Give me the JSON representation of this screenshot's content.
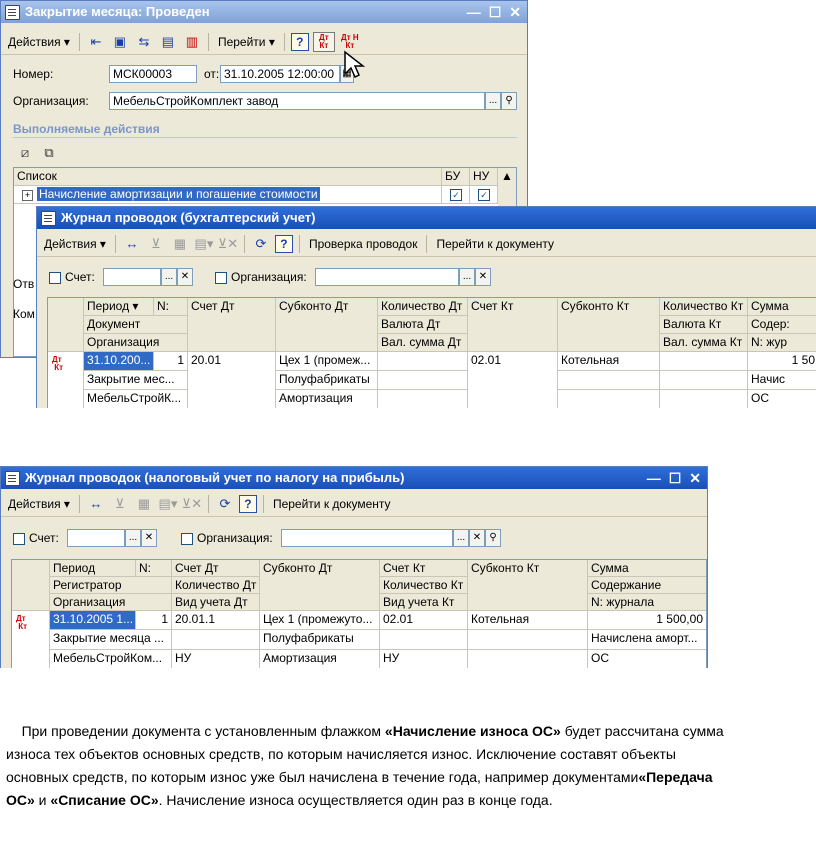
{
  "win1": {
    "title": "Закрытие месяца: Проведен",
    "toolbar": {
      "actions": "Действия ▾",
      "goto": "Перейти ▾",
      "help": "?",
      "dtkt_top": "Дт",
      "dtkt_bottom": "Кт",
      "dtkt2_top": "Дт Н",
      "dtkt2_bottom": "Кт"
    },
    "number_label": "Номер:",
    "number_value": "МСК00003",
    "date_label": "от:",
    "date_value": "31.10.2005 12:00:00",
    "org_label": "Организация:",
    "org_value": "МебельСтройКомплект завод",
    "section_label": "Выполняемые действия",
    "list": {
      "headers": {
        "list": "Список",
        "bu": "БУ",
        "nu": "НУ"
      },
      "first_item": "Начисление амортизации и погашение стоимости"
    },
    "side_labels": {
      "a": "Отв",
      "b": "Ком"
    }
  },
  "win2": {
    "title": "Журнал проводок (бухгалтерский учет)",
    "toolbar": {
      "actions": "Действия ▾",
      "check": "Проверка проводок",
      "goto_doc": "Перейти к документу",
      "help": "?"
    },
    "filter": {
      "account_label": "Счет:",
      "org_label": "Организация:"
    },
    "headers": {
      "row1": [
        "Период ▾",
        "N:",
        "Счет Дт",
        "Субконто Дт",
        "Количество Дт",
        "Счет Кт",
        "Субконто Кт",
        "Количество Кт",
        "Сумма"
      ],
      "row2": [
        "Документ",
        "Валюта Дт",
        "Валюта Кт",
        "Содер:"
      ],
      "row3": [
        "Организация",
        "Вал. сумма Дт",
        "Вал. сумма Кт",
        "N: жур"
      ]
    },
    "rows": {
      "period": "31.10.200...",
      "n": "1",
      "account_dt": "20.01",
      "sub_dt_1": "Цех 1 (промеж...",
      "account_kt": "02.01",
      "sub_kt_1": "Котельная",
      "sum": "1 50",
      "document": "Закрытие мес...",
      "sub_dt_2": "Полуфабрикаты",
      "content": "Начис",
      "organization": "МебельСтройК...",
      "sub_dt_3": "Амортизация",
      "journal": "ОС"
    }
  },
  "win3": {
    "title": "Журнал проводок (налоговый учет по налогу на прибыль)",
    "toolbar": {
      "actions": "Действия ▾",
      "goto_doc": "Перейти к документу",
      "help": "?"
    },
    "filter": {
      "account_label": "Счет:",
      "org_label": "Организация:"
    },
    "headers": {
      "row1": [
        "Период",
        "N:",
        "Счет Дт",
        "Субконто Дт",
        "Счет Кт",
        "Субконто Кт",
        "Сумма"
      ],
      "row2": [
        "Регистратор",
        "Количество Дт",
        "Количество Кт",
        "Содержание"
      ],
      "row3": [
        "Организация",
        "Вид учета Дт",
        "Вид учета Кт",
        "N: журнала"
      ]
    },
    "rows": {
      "period": "31.10.2005 1...",
      "n": "1",
      "account_dt": "20.01.1",
      "sub_dt_1": "Цех 1 (промежуто...",
      "account_kt": "02.01",
      "sub_kt_1": "Котельная",
      "sum": "1 500,00",
      "registrar": "Закрытие месяца ...",
      "sub_dt_2": "Полуфабрикаты",
      "content": "Начислена аморт...",
      "organization": "МебельСтройКом...",
      "type_dt": "НУ",
      "sub_dt_3": "Амортизация",
      "type_kt": "НУ",
      "journal": "ОС"
    }
  },
  "paragraph": {
    "t1": "При проведении документа с установленным флажком ",
    "b1": "«Начисление износа ОС»",
    "t2": " будет рассчитана сумма износа тех объектов основных средств, по которым начисляется износ. Исключение составят объекты основных средств, по которым износ уже был начислена в течение года, например документами",
    "b2": "«Передача ОС»",
    "t3": " и ",
    "b3": "«Списание ОС»",
    "t4": ". Начисление износа осуществляется один раз в конце года."
  }
}
